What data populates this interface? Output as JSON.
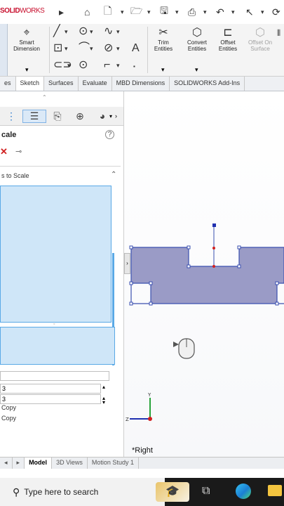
{
  "app": {
    "logo_bold": "SOLID",
    "logo_light": "WORKS"
  },
  "ribbon": {
    "smart_dimension": "Smart Dimension",
    "trim_entities": "Trim Entities",
    "convert_entities": "Convert Entities",
    "offset_entities": "Offset Entities",
    "offset_on_surface": "Offset On Surface"
  },
  "tabs": [
    "es",
    "Sketch",
    "Surfaces",
    "Evaluate",
    "MBD Dimensions",
    "SOLIDWORKS Add-Ins"
  ],
  "active_tab": "Sketch",
  "panel": {
    "title": "cale",
    "section": "s to Scale",
    "help": "?",
    "field1": "3",
    "field2": "3",
    "copy1": "Copy",
    "copy2": "Copy"
  },
  "viewport": {
    "view_label": "*Right"
  },
  "bottom_tabs": [
    "Model",
    "3D Views",
    "Motion Study 1"
  ],
  "taskbar": {
    "search_placeholder": "Type here to search"
  },
  "colors": {
    "sketch_fill": "#9a9bc6",
    "sketch_stroke": "#3a4fb0",
    "selection": "#cfe6f8"
  }
}
